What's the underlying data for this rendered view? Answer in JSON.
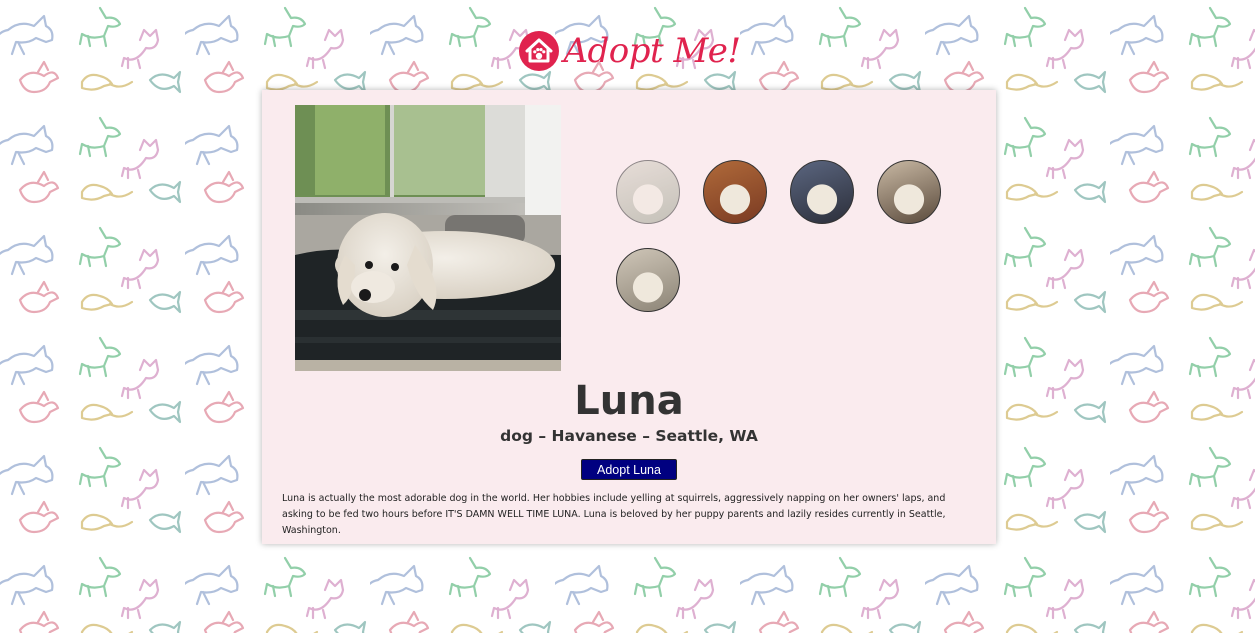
{
  "brand": {
    "name": "Adopt Me!",
    "color": "#e0234e",
    "logo_icon": "house-paw-icon"
  },
  "background": {
    "pattern_icons": [
      "unicorn-icon",
      "goat-icon",
      "cat-icon",
      "dragon-icon",
      "rat-icon",
      "fish-icon"
    ],
    "pattern_colors": [
      "#a3b5d6",
      "#7fc79a",
      "#d9a3c9",
      "#e39aa8",
      "#d8c27f",
      "#8fbdb6"
    ]
  },
  "pet": {
    "name": "Luna",
    "subtitle": "dog – Havanese – Seattle, WA",
    "adopt_label": "Adopt Luna",
    "description": "Luna is actually the most adorable dog in the world. Her hobbies include yelling at squirrels, aggressively napping on her owners' laps, and asking to be fed two hours before IT'S DAMN WELL TIME LUNA. Luna is beloved by her puppy parents and lazily resides currently in Seattle, Washington."
  },
  "gallery": {
    "active_index": 0,
    "images": [
      {
        "name": "photo-1",
        "palette": [
          "#9aa08e",
          "#d8d2c6"
        ]
      },
      {
        "name": "photo-2",
        "palette": [
          "#7a3a22",
          "#b06a3a"
        ]
      },
      {
        "name": "photo-3",
        "palette": [
          "#2c2f3a",
          "#5b6680"
        ]
      },
      {
        "name": "photo-4",
        "palette": [
          "#5a4a3c",
          "#c9b9a4"
        ]
      },
      {
        "name": "photo-5",
        "palette": [
          "#8c8476",
          "#cfc6b8"
        ]
      }
    ]
  },
  "theme": {
    "card_bg": "#faebee",
    "button_bg": "#000080",
    "button_text": "#ffffff",
    "text": "#333333"
  }
}
